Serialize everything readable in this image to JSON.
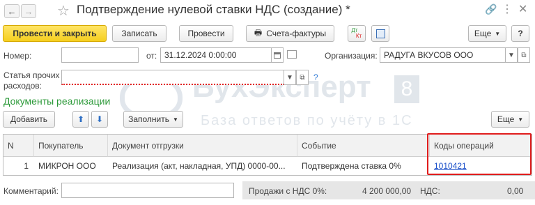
{
  "window": {
    "title": "Подтверждение нулевой ставки НДС (создание) *"
  },
  "toolbar": {
    "post_close_label": "Провести и закрыть",
    "save_label": "Записать",
    "post_label": "Провести",
    "invoices_label": "Счета-фактуры",
    "dt_kt_label_dt": "Дт",
    "dt_kt_label_kt": "Кт",
    "more_label": "Еще",
    "help_label": "?"
  },
  "header": {
    "number_label": "Номер:",
    "number_value": "",
    "date_label": "от:",
    "date_value": "31.12.2024  0:00:00",
    "org_label": "Организация:",
    "org_value": "РАДУГА ВКУСОВ ООО",
    "other_expenses_label_line1": "Статья прочих",
    "other_expenses_label_line2": "расходов:",
    "other_expenses_value": "",
    "question_mark": "?"
  },
  "section": {
    "title": "Документы реализации"
  },
  "table_toolbar": {
    "add_label": "Добавить",
    "fill_label": "Заполнить",
    "more_label": "Еще"
  },
  "table": {
    "columns": [
      "N",
      "Покупатель",
      "Документ отгрузки",
      "Событие",
      "Коды операций"
    ],
    "rows": [
      [
        "1",
        "МИКРОН ООО",
        "Реализация (акт, накладная, УПД) 0000-00...",
        "Подтверждена ставка 0%",
        "1010421"
      ]
    ]
  },
  "footer": {
    "comment_label": "Комментарий:",
    "comment_value": "",
    "sales_label": "Продажи с НДС 0%:",
    "sales_value": "4 200 000,00",
    "vat_label": "НДС:",
    "vat_value": "0,00"
  },
  "watermark": {
    "line1": "БухЭксперт",
    "badge": "8",
    "line2": "База ответов по учёту в 1С"
  },
  "colors": {
    "primary_button": "#f5cf1f",
    "section_title": "#2d9a3a",
    "link": "#1a4fc9",
    "highlight_border": "#e01c1c"
  }
}
